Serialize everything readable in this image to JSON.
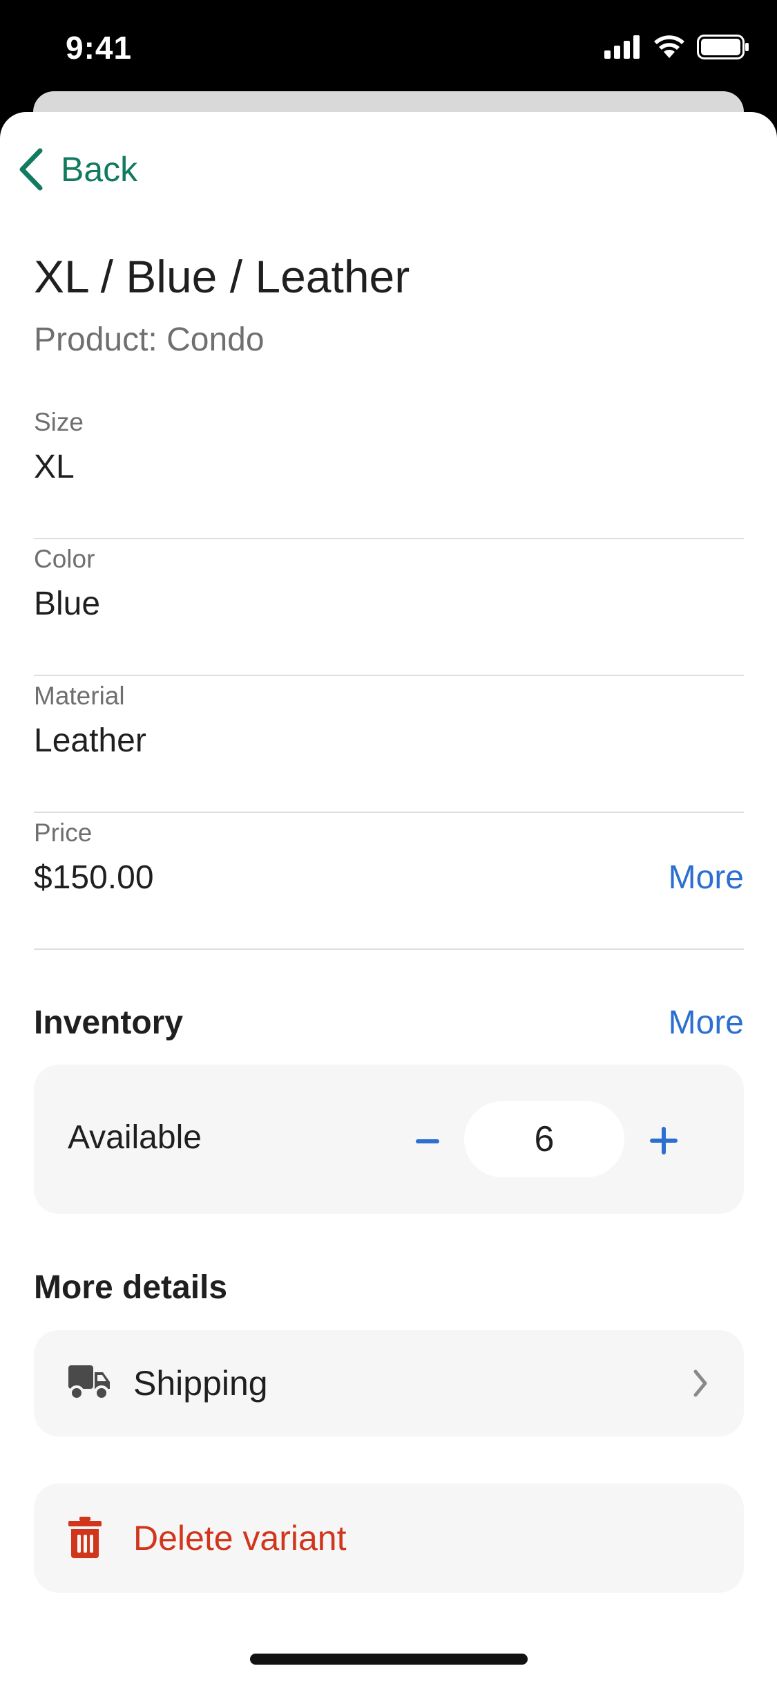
{
  "status_bar": {
    "time": "9:41"
  },
  "nav": {
    "back_label": "Back"
  },
  "header": {
    "title": "XL / Blue / Leather",
    "subtitle": "Product: Condo"
  },
  "fields": [
    {
      "label": "Size",
      "value": "XL"
    },
    {
      "label": "Color",
      "value": "Blue"
    },
    {
      "label": "Material",
      "value": "Leather"
    },
    {
      "label": "Price",
      "value": "$150.00",
      "action": "More"
    }
  ],
  "inventory": {
    "heading": "Inventory",
    "more_label": "More",
    "available_label": "Available",
    "quantity": "6"
  },
  "more_details": {
    "heading": "More details",
    "shipping_label": "Shipping"
  },
  "delete": {
    "label": "Delete variant"
  },
  "colors": {
    "accent_green": "#117a5f",
    "link_blue": "#2b6fd0",
    "destructive_red": "#d1351b"
  }
}
